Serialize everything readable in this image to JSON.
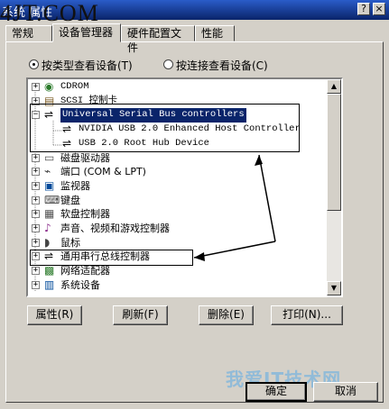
{
  "window": {
    "title": "系统 属性",
    "help_glyph": "?",
    "close_glyph": "×"
  },
  "watermark_top": "4JT.COM",
  "watermark_bottom": "我爱IT技术网",
  "tabs": [
    {
      "label": "常规"
    },
    {
      "label": "设备管理器"
    },
    {
      "label": "硬件配置文件"
    },
    {
      "label": "性能"
    }
  ],
  "view_options": {
    "by_type": "按类型查看设备(T)",
    "by_connection": "按连接查看设备(C)",
    "selected": "by_type"
  },
  "tree": {
    "items": [
      {
        "label": "CDROM",
        "expander": "+",
        "icon": "cdrom-icon",
        "indent": 0
      },
      {
        "label": "SCSI 控制卡",
        "expander": "+",
        "icon": "scsi-icon",
        "indent": 0
      },
      {
        "label": "Universal Serial Bus controllers",
        "expander": "−",
        "icon": "usb-icon",
        "indent": 0,
        "selected": true
      },
      {
        "label": "NVIDIA USB 2.0 Enhanced Host Controller",
        "expander": "",
        "icon": "usb-icon",
        "indent": 1
      },
      {
        "label": "USB 2.0 Root Hub Device",
        "expander": "",
        "icon": "usb-icon",
        "indent": 1
      },
      {
        "label": "磁盘驱动器",
        "expander": "+",
        "icon": "disk-drive-icon",
        "indent": 0
      },
      {
        "label": "端口 (COM & LPT)",
        "expander": "+",
        "icon": "port-icon",
        "indent": 0
      },
      {
        "label": "监视器",
        "expander": "+",
        "icon": "monitor-icon",
        "indent": 0
      },
      {
        "label": "键盘",
        "expander": "+",
        "icon": "keyboard-icon",
        "indent": 0
      },
      {
        "label": "软盘控制器",
        "expander": "+",
        "icon": "floppy-controller-icon",
        "indent": 0
      },
      {
        "label": "声音、视频和游戏控制器",
        "expander": "+",
        "icon": "sound-icon",
        "indent": 0
      },
      {
        "label": "鼠标",
        "expander": "+",
        "icon": "mouse-icon",
        "indent": 0
      },
      {
        "label": "通用串行总线控制器",
        "expander": "+",
        "icon": "usb-icon",
        "indent": 0
      },
      {
        "label": "网络适配器",
        "expander": "+",
        "icon": "network-icon",
        "indent": 0
      },
      {
        "label": "系统设备",
        "expander": "+",
        "icon": "system-icon",
        "indent": 0
      }
    ]
  },
  "buttons": {
    "properties": "属性(R)",
    "refresh": "刷新(F)",
    "remove": "删除(E)",
    "print": "打印(N)...",
    "ok": "确定",
    "cancel": "取消"
  },
  "colors": {
    "selection": "#0a246a",
    "face": "#d4d0c8",
    "titlebar": "#0a246a"
  }
}
